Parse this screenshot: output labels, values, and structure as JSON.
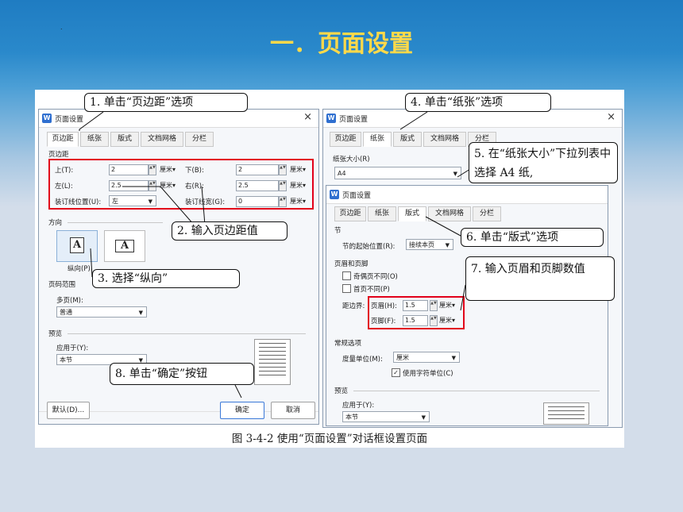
{
  "slide": {
    "title": "一．页面设置",
    "dot": "."
  },
  "dialog1": {
    "window_title": "页面设置",
    "close": "×",
    "tabs": [
      "页边距",
      "纸张",
      "版式",
      "文档网格",
      "分栏"
    ],
    "section_margins": "页边距",
    "top_label": "上(T):",
    "top_value": "2",
    "bottom_label": "下(B):",
    "bottom_value": "2",
    "left_label": "左(L):",
    "left_value": "2.5",
    "right_label": "右(R):",
    "right_value": "2.5",
    "gutter_pos_label": "装订线位置(U):",
    "gutter_pos_value": "左",
    "gutter_width_label": "装订线宽(G):",
    "gutter_width_value": "0",
    "unit": "厘米▾",
    "section_orientation": "方向",
    "portrait_label": "纵向(P)",
    "section_pages": "页码范围",
    "multi_pages_label": "多页(M):",
    "multi_pages_value": "普通",
    "section_preview": "预览",
    "apply_to_label": "应用于(Y):",
    "apply_to_value": "本节",
    "default_button": "默认(D)...",
    "ok_button": "确定",
    "cancel_button": "取消"
  },
  "dialog2": {
    "window_title": "页面设置",
    "close": "×",
    "tabs": [
      "页边距",
      "纸张",
      "版式",
      "文档网格",
      "分栏"
    ],
    "paper_size_label": "纸张大小(R)",
    "paper_size_value": "A4"
  },
  "dialog3": {
    "window_title": "页面设置",
    "tabs": [
      "页边距",
      "纸张",
      "版式",
      "文档网格",
      "分栏"
    ],
    "section_section": "节",
    "section_start_label": "节的起始位置(R):",
    "section_start_value": "接续本页",
    "section_header_footer": "页眉和页脚",
    "odd_even_label": "奇偶页不同(O)",
    "first_page_label": "首页不同(P)",
    "from_edge_label": "距边界:",
    "header_label": "页眉(H):",
    "header_value": "1.5",
    "footer_label": "页脚(F):",
    "footer_value": "1.5",
    "unit": "厘米▾",
    "section_general": "常规选项",
    "measure_unit_label": "度量单位(M):",
    "measure_unit_value": "厘米",
    "char_unit_label": "使用字符单位(C)",
    "section_preview": "预览",
    "apply_to_label": "应用于(Y):",
    "apply_to_value": "本节"
  },
  "callouts": {
    "c1": "1. 单击“页边距”选项",
    "c2": "2. 输入页边距值",
    "c3": "3. 选择“纵向”",
    "c4": "4. 单击“纸张”选项",
    "c5": "5. 在“纸张大小”下拉列表中选择 A4 纸,",
    "c6": "6. 单击“版式”选项",
    "c7": "7. 输入页眉和页脚数值",
    "c8": "8. 单击“确定”按钮"
  },
  "caption": "图 3-4-2 使用“页面设置”对话框设置页面",
  "colors": {
    "title": "#ffd94a",
    "highlight_red": "#e2001a",
    "accent_blue": "#2f6fd0"
  }
}
